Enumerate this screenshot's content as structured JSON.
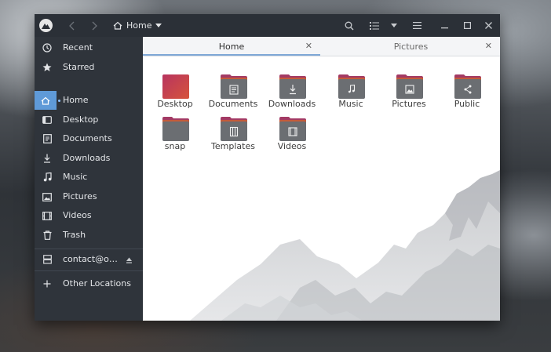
{
  "titlebar": {
    "location": "Home",
    "back_icon": "chevron-left-icon",
    "forward_icon": "chevron-right-icon"
  },
  "sidebar": {
    "items": [
      {
        "label": "Recent",
        "icon": "clock-icon"
      },
      {
        "label": "Starred",
        "icon": "star-icon"
      },
      {
        "label": "Home",
        "icon": "home-icon",
        "active": true
      },
      {
        "label": "Desktop",
        "icon": "desktop-icon"
      },
      {
        "label": "Documents",
        "icon": "document-icon"
      },
      {
        "label": "Downloads",
        "icon": "download-icon"
      },
      {
        "label": "Music",
        "icon": "music-icon"
      },
      {
        "label": "Pictures",
        "icon": "picture-icon"
      },
      {
        "label": "Videos",
        "icon": "video-icon"
      },
      {
        "label": "Trash",
        "icon": "trash-icon"
      }
    ],
    "network": {
      "label": "contact@o…",
      "icon": "server-icon",
      "eject_icon": "eject-icon"
    },
    "other": {
      "label": "Other Locations",
      "icon": "plus-icon"
    }
  },
  "tabs": [
    {
      "label": "Home",
      "active": true
    },
    {
      "label": "Pictures",
      "active": false
    }
  ],
  "folders": [
    {
      "name": "Desktop",
      "emblem": "none"
    },
    {
      "name": "Documents",
      "emblem": "document-icon"
    },
    {
      "name": "Downloads",
      "emblem": "download-icon"
    },
    {
      "name": "Music",
      "emblem": "music-icon"
    },
    {
      "name": "Pictures",
      "emblem": "picture-icon"
    },
    {
      "name": "Public",
      "emblem": "share-icon"
    },
    {
      "name": "snap",
      "emblem": "none"
    },
    {
      "name": "Templates",
      "emblem": "template-icon"
    },
    {
      "name": "Videos",
      "emblem": "video-icon"
    }
  ],
  "colors": {
    "accent": "#5f9ad8",
    "folder_tab": "#a33a64",
    "folder_body": "#6b6e72",
    "desktop_folder_top": "#b8345f",
    "desktop_folder_bottom": "#d6543c"
  }
}
